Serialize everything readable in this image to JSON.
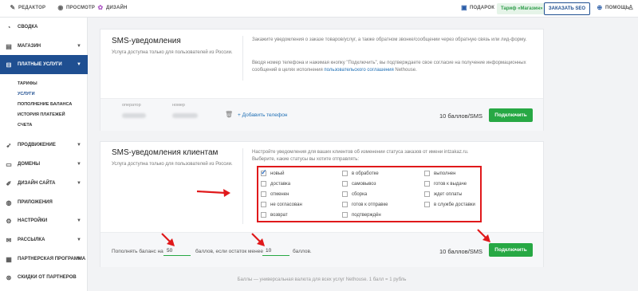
{
  "topbar": {
    "editor": "РЕДАКТОР",
    "preview": "ПРОСМОТР",
    "design": "ДИЗАЙН",
    "gift": "ПОДАРОК",
    "tariff": "Тариф «Магазин»",
    "seo": "ЗАКАЗАТЬ SEO",
    "help": "ПОМОЩЬ"
  },
  "sidebar": {
    "summary": "СВОДКА",
    "shop": "МАГАЗИН",
    "paid": "ПЛАТНЫЕ УСЛУГИ",
    "sub": [
      "ТАРИФЫ",
      "УСЛУГИ",
      "ПОПОЛНЕНИЕ БАЛАНСА",
      "ИСТОРИЯ ПЛАТЕЖЕЙ",
      "СЧЕТА"
    ],
    "promo": "ПРОДВИЖЕНИЕ",
    "domains": "ДОМЕНЫ",
    "site_design": "ДИЗАЙН САЙТА",
    "apps": "ПРИЛОЖЕНИЯ",
    "settings": "НАСТРОЙКИ",
    "mailing": "РАССЫЛКА",
    "partner": "ПАРТНЕРСКАЯ ПРОГРАММА",
    "discounts": "СКИДКИ ОТ ПАРТНЕРОВ"
  },
  "card1": {
    "title": "SMS-уведомления",
    "subtitle": "Услуга доступна только для пользователей из России.",
    "desc1": "Закажите уведомления о заказе товаров/услуг, а также обратном звонке/сообщении через обратную связь или лид-форму.",
    "desc2_pre": "Вводя номер телефона и нажимая кнопку \"Подключить\", вы подтверждаете свое согласие на получение информационных сообщений в целях исполнения ",
    "desc2_link": "пользовательского соглашения",
    "desc2_post": " Nethouse.",
    "operator_label": "оператор",
    "number_label": "номер",
    "add_phone": "+ Добавить телефон",
    "price": "10 баллов/SMS",
    "connect": "Подключить"
  },
  "card2": {
    "title": "SMS-уведомления клиентам",
    "subtitle": "Услуга доступна только для пользователей из России.",
    "desc1": "Настройте уведомления для ваших клиентов об изменении статуса заказов от имени intzakaz.ru.",
    "desc2": "Выберите, какие статусы вы хотите отправлять:",
    "statuses": [
      {
        "label": "новый",
        "checked": true
      },
      {
        "label": "доставка",
        "checked": false
      },
      {
        "label": "отменен",
        "checked": false
      },
      {
        "label": "не согласован",
        "checked": false
      },
      {
        "label": "возврат",
        "checked": false
      },
      {
        "label": "в обработке",
        "checked": false
      },
      {
        "label": "самовывоз",
        "checked": false
      },
      {
        "label": "сборка",
        "checked": false
      },
      {
        "label": "готов к отправке",
        "checked": false
      },
      {
        "label": "подтверждён",
        "checked": false
      },
      {
        "label": "выполнен",
        "checked": false
      },
      {
        "label": "готов к выдаче",
        "checked": false
      },
      {
        "label": "ждет оплаты",
        "checked": false
      },
      {
        "label": "в службе доставки",
        "checked": false
      }
    ],
    "bal_pre": "Пополнять баланс на",
    "bal_amount": "50",
    "bal_mid": "баллов, если остаток менее",
    "bal_threshold": "10",
    "bal_post": "баллов.",
    "price": "10 баллов/SMS",
    "connect": "Подключить"
  },
  "footer_note": "Баллы — универсальная валюта для всех услуг Nethouse. 1 балл = 1 рубль",
  "colors": {
    "accent": "#1f4f91",
    "green": "#27a844",
    "red": "#e0191b"
  }
}
